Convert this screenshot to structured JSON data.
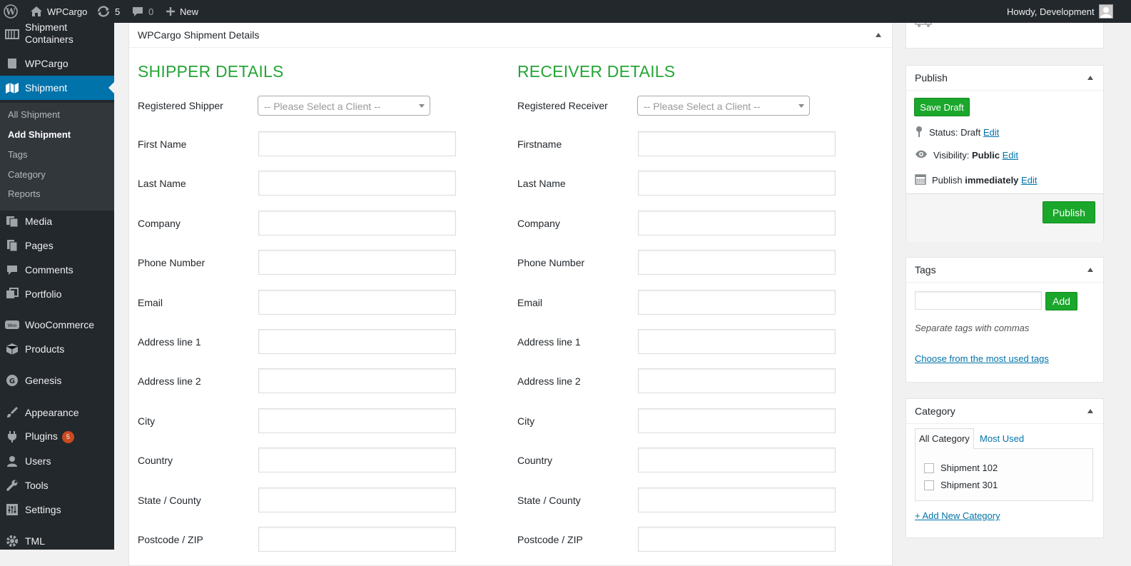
{
  "adminbar": {
    "site_name": "WPCargo",
    "updates_count": "5",
    "comments_count": "0",
    "new_label": "New",
    "howdy": "Howdy, Development"
  },
  "sidebar": {
    "items": [
      {
        "label": "Shipment Containers",
        "icon": "container-icon"
      },
      {
        "label": "WPCargo",
        "icon": "book-icon"
      },
      {
        "label": "Shipment",
        "icon": "map-icon",
        "current": true
      },
      {
        "label": "Media",
        "icon": "media-icon"
      },
      {
        "label": "Pages",
        "icon": "pages-icon"
      },
      {
        "label": "Comments",
        "icon": "comments-icon"
      },
      {
        "label": "Portfolio",
        "icon": "portfolio-icon"
      },
      {
        "label": "WooCommerce",
        "icon": "woo-icon"
      },
      {
        "label": "Products",
        "icon": "products-icon"
      },
      {
        "label": "Genesis",
        "icon": "genesis-icon"
      },
      {
        "label": "Appearance",
        "icon": "brush-icon"
      },
      {
        "label": "Plugins",
        "icon": "plug-icon",
        "badge": "5"
      },
      {
        "label": "Users",
        "icon": "users-icon"
      },
      {
        "label": "Tools",
        "icon": "wrench-icon"
      },
      {
        "label": "Settings",
        "icon": "settings-icon"
      },
      {
        "label": "TML",
        "icon": "gear-icon"
      }
    ],
    "submenu": [
      "All Shipment",
      "Add Shipment",
      "Tags",
      "Category",
      "Reports"
    ]
  },
  "main": {
    "box_title": "WPCargo Shipment Details",
    "shipper": {
      "title": "SHIPPER DETAILS",
      "registered_label": "Registered Shipper",
      "select_placeholder": "-- Please Select a Client --",
      "fields": [
        "First Name",
        "Last Name",
        "Company",
        "Phone Number",
        "Email",
        "Address line 1",
        "Address line 2",
        "City",
        "Country",
        "State / County",
        "Postcode / ZIP"
      ]
    },
    "receiver": {
      "title": "RECEIVER DETAILS",
      "registered_label": "Registered Receiver",
      "select_placeholder": "-- Please Select a Client --",
      "fields": [
        "Firstname",
        "Last Name",
        "Company",
        "Phone Number",
        "Email",
        "Address line 1",
        "Address line 2",
        "City",
        "Country",
        "State / County",
        "Postcode / ZIP"
      ]
    }
  },
  "publish": {
    "title": "Publish",
    "save_draft": "Save Draft",
    "status_label": "Status:",
    "status_value": "Draft",
    "visibility_label": "Visibility:",
    "visibility_value": "Public",
    "publish_label": "Publish",
    "publish_value": "immediately",
    "edit": "Edit",
    "publish_button": "Publish"
  },
  "tags": {
    "title": "Tags",
    "add_button": "Add",
    "hint": "Separate tags with commas",
    "choose_link": "Choose from the most used tags"
  },
  "category": {
    "title": "Category",
    "tab_all": "All Category",
    "tab_most": "Most Used",
    "items": [
      "Shipment 102",
      "Shipment 301"
    ],
    "add_link": "+ Add New Category"
  }
}
